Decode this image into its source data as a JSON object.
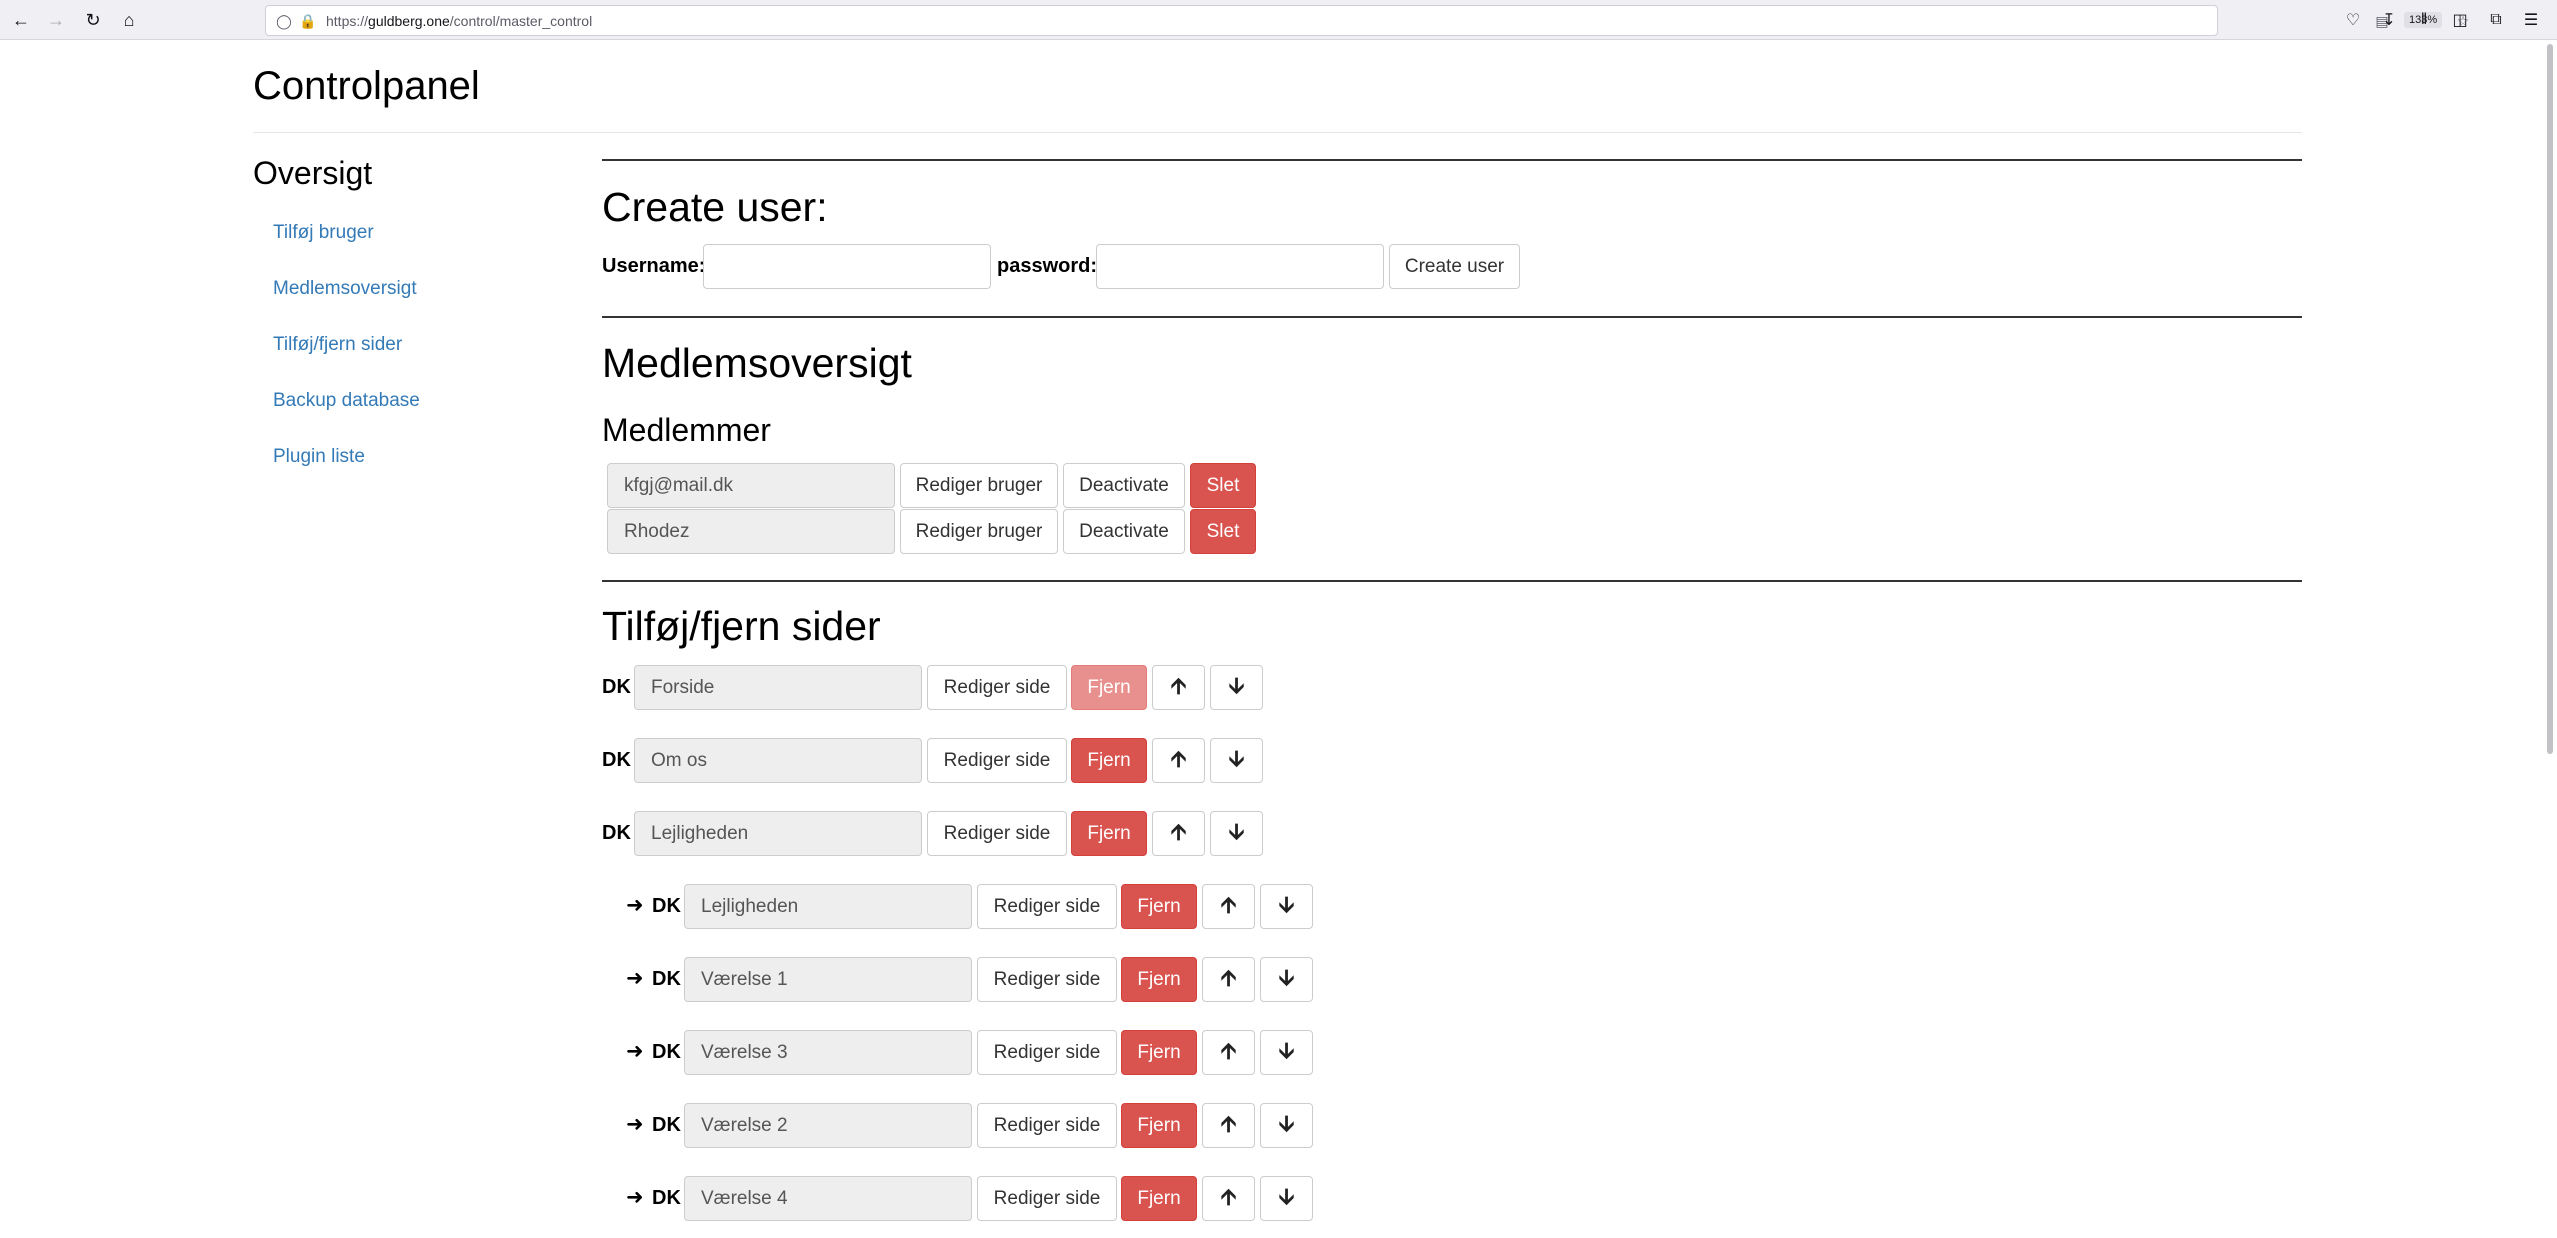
{
  "browser": {
    "url_prefix": "https://",
    "url_host": "guldberg.one",
    "url_path": "/control/master_control",
    "zoom": "133%"
  },
  "page_title": "Controlpanel",
  "sidebar": {
    "title": "Oversigt",
    "items": [
      {
        "label": "Tilføj bruger"
      },
      {
        "label": "Medlemsoversigt"
      },
      {
        "label": "Tilføj/fjern sider"
      },
      {
        "label": "Backup database"
      },
      {
        "label": "Plugin liste"
      }
    ]
  },
  "create_user": {
    "heading": "Create user:",
    "username_label": "Username:",
    "username_value": "",
    "password_label": "password:",
    "password_value": "",
    "submit_label": "Create user"
  },
  "members": {
    "heading": "Medlemsoversigt",
    "subheading": "Medlemmer",
    "edit_label": "Rediger bruger",
    "deactivate_label": "Deactivate",
    "delete_label": "Slet",
    "list": [
      {
        "name": "kfgj@mail.dk"
      },
      {
        "name": "Rhodez"
      }
    ]
  },
  "pages": {
    "heading": "Tilføj/fjern sider",
    "edit_label": "Rediger side",
    "remove_label": "Fjern",
    "child_prefix": "➜",
    "up_icon": "arrow-up-icon",
    "down_icon": "arrow-down-icon",
    "list": [
      {
        "lang": "DK",
        "name": "Forside",
        "child": false,
        "remove_disabled": true
      },
      {
        "lang": "DK",
        "name": "Om os",
        "child": false,
        "remove_disabled": false
      },
      {
        "lang": "DK",
        "name": "Lejligheden",
        "child": false,
        "remove_disabled": false
      },
      {
        "lang": "DK",
        "name": "Lejligheden",
        "child": true,
        "remove_disabled": false
      },
      {
        "lang": "DK",
        "name": "Værelse 1",
        "child": true,
        "remove_disabled": false
      },
      {
        "lang": "DK",
        "name": "Værelse 3",
        "child": true,
        "remove_disabled": false
      },
      {
        "lang": "DK",
        "name": "Værelse 2",
        "child": true,
        "remove_disabled": false
      },
      {
        "lang": "DK",
        "name": "Værelse 4",
        "child": true,
        "remove_disabled": false
      }
    ]
  },
  "colors": {
    "danger": "#d9534f",
    "danger_disabled": "#e8908d",
    "link": "#337ab7"
  }
}
